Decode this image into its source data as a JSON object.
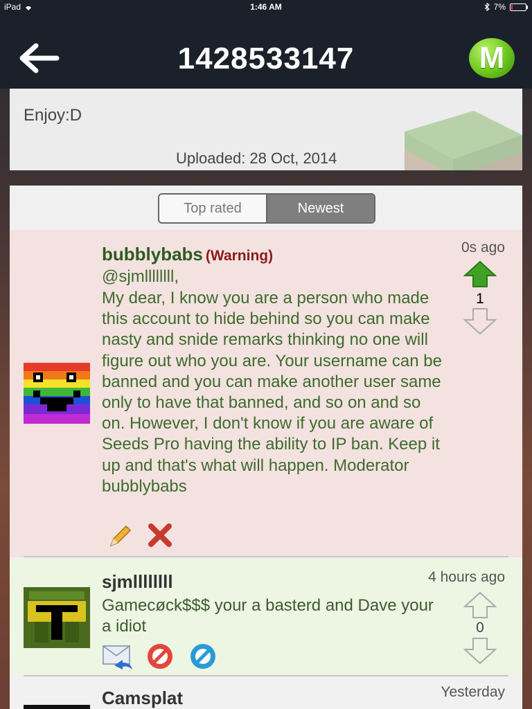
{
  "status_bar": {
    "device": "iPad",
    "time": "1:46 AM",
    "battery": "7%"
  },
  "header": {
    "title": "1428533147",
    "logo_letter": "M"
  },
  "seed_info": {
    "description": "Enjoy:D",
    "uploaded": "Uploaded: 28 Oct, 2014"
  },
  "tabs": [
    {
      "label": "Top rated",
      "active": false
    },
    {
      "label": "Newest",
      "active": true
    }
  ],
  "comments": [
    {
      "username": "bubblybabs",
      "badge": "(Warning)",
      "mention": "@sjmllllllll,",
      "text": "My dear, I know you are a person who made this account to hide behind so you can make nasty and snide remarks thinking no one will figure out who you are.  Your username can be banned and you can make another user same only to have that banned, and so on and so on. However, I don't know if you are aware of Seeds Pro having the ability to IP ban. Keep it up and that's what will happen. Moderator bubblybabs",
      "time": "0s ago",
      "score": "1"
    },
    {
      "username": "sjmllllllll",
      "text": "Gamecøck$$$ your a basterd and Dave your a idiot",
      "time": "4 hours ago",
      "score": "0"
    },
    {
      "username": "Camsplat",
      "time": "Yesterday"
    }
  ],
  "colors": {
    "nav_bg": "#1b212b",
    "username_green": "#2f5a1f",
    "warning_red": "#8b1a1a",
    "upvote_green": "#3fa126"
  }
}
